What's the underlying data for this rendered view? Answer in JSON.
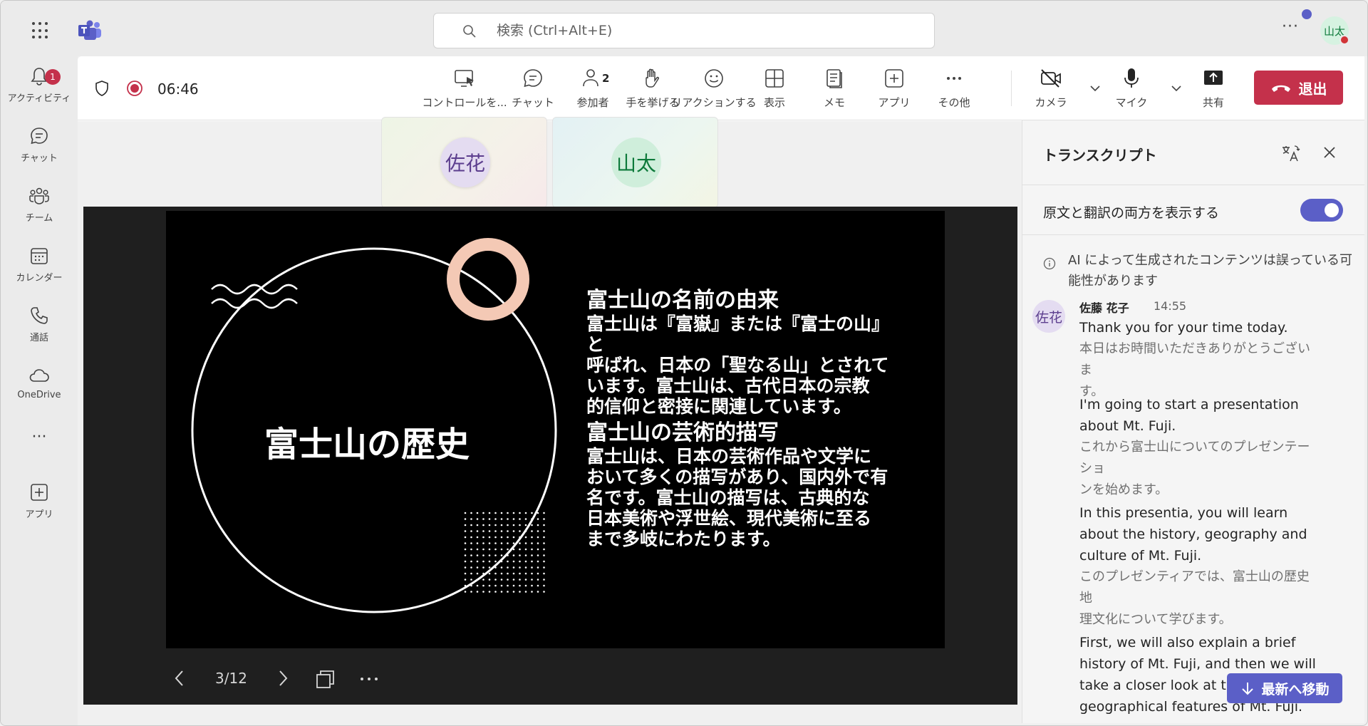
{
  "topbar": {
    "search_placeholder": "検索 (Ctrl+Alt+E)",
    "more": "···",
    "user_initials": "山太"
  },
  "rail": {
    "items": [
      {
        "label": "アクティビティ",
        "badge": "1"
      },
      {
        "label": "チャット"
      },
      {
        "label": "チーム"
      },
      {
        "label": "カレンダー"
      },
      {
        "label": "通話"
      },
      {
        "label": "OneDrive"
      },
      {
        "label": "···"
      },
      {
        "label": "アプリ"
      }
    ]
  },
  "meeting": {
    "timer": "06:46",
    "toolbar": [
      {
        "label": "コントロールを..."
      },
      {
        "label": "チャット"
      },
      {
        "label": "参加者",
        "count": "2"
      },
      {
        "label": "手を挙げる"
      },
      {
        "label": "リアクションする"
      },
      {
        "label": "表示"
      },
      {
        "label": "メモ"
      },
      {
        "label": "アプリ"
      },
      {
        "label": "その他"
      },
      {
        "label": "カメラ"
      },
      {
        "label": "マイク"
      },
      {
        "label": "共有"
      }
    ],
    "leave_label": "退出"
  },
  "participants": [
    {
      "initials": "佐花"
    },
    {
      "initials": "山太"
    }
  ],
  "slide": {
    "title": "富士山の歴史",
    "section1_heading": "富士山の名前の由来",
    "section1_lines": [
      "富士山は『富嶽』または『富士の山』と",
      "呼ばれ、日本の「聖なる山」とされて",
      "います。富士山は、古代日本の宗教",
      "的信仰と密接に関連しています。"
    ],
    "section2_heading": "富士山の芸術的描写",
    "section2_lines": [
      "富士山は、日本の芸術作品や文学に",
      "おいて多くの描写があり、国内外で有",
      "名です。富士山の描写は、古典的な",
      "日本美術や浮世絵、現代美術に至る",
      "まで多岐にわたります。"
    ],
    "page_indicator": "3/12"
  },
  "transcript": {
    "title": "トランスクリプト",
    "toggle_label": "原文と翻訳の両方を表示する",
    "toggle_on": true,
    "ai_notice": "AI によって生成されたコンテンツは誤っている可能性があります",
    "speaker": {
      "initials": "佐花",
      "name": "佐藤 花子",
      "time": "14:55"
    },
    "entries": [
      {
        "en": [
          "Thank you for your time today."
        ],
        "ja": [
          "本日はお時間いただきありがとうございま",
          "す。"
        ]
      },
      {
        "en": [
          "I'm going to start a presentation",
          "about Mt. Fuji."
        ],
        "ja": [
          "これから富士山についてのプレゼンテーショ",
          "ンを始めます。"
        ]
      },
      {
        "en": [
          "In this presentia, you will learn",
          "about the history, geography and",
          "culture of Mt. Fuji."
        ],
        "ja": [
          "このプレゼンティアでは、富士山の歴史地",
          "理文化について学びます。"
        ]
      },
      {
        "en": [
          "First, we will also explain a brief",
          "history of Mt. Fuji, and then we will",
          "take a closer look at the",
          "geographical features of Mt. Fuji."
        ],
        "ja": []
      }
    ],
    "jump_label": "最新へ移動"
  },
  "colors": {
    "accent": "#5b5fc7",
    "leave": "#c4314b",
    "ring": "#f4c9b5"
  }
}
